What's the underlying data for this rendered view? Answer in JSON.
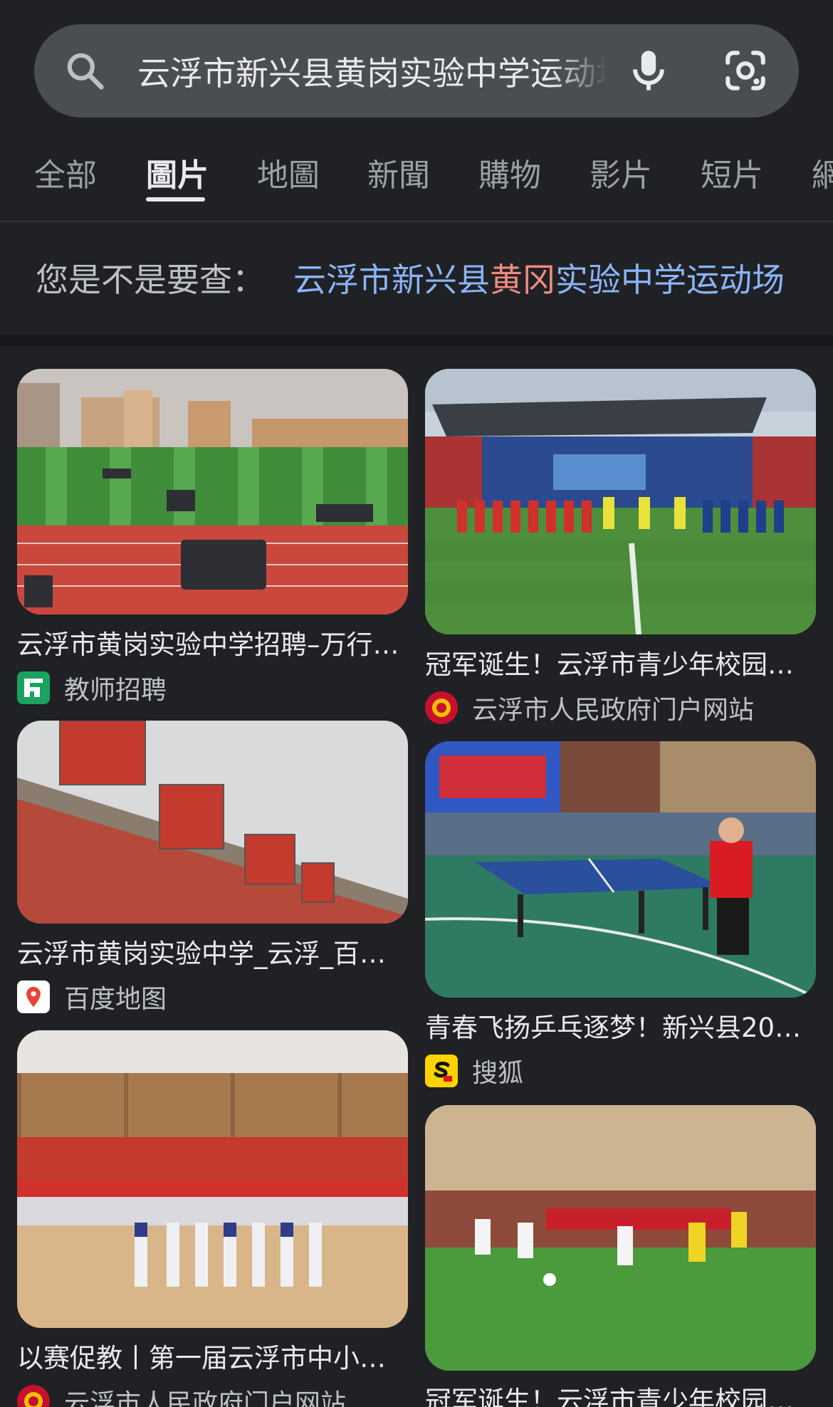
{
  "search": {
    "query": "云浮市新兴县黄岗实验中学运动场",
    "icons": {
      "search": "search-icon",
      "voice": "mic-icon",
      "lens": "google-lens-icon"
    }
  },
  "tabs": [
    {
      "label": "全部",
      "active": false
    },
    {
      "label": "圖片",
      "active": true
    },
    {
      "label": "地圖",
      "active": false
    },
    {
      "label": "新聞",
      "active": false
    },
    {
      "label": "購物",
      "active": false
    },
    {
      "label": "影片",
      "active": false
    },
    {
      "label": "短片",
      "active": false
    },
    {
      "label": "網",
      "active": false
    }
  ],
  "did_you_mean": {
    "label": "您是不是要查：",
    "before": "云浮市新兴县",
    "highlight": "黄冈",
    "after": "实验中学运动场"
  },
  "results": [
    {
      "caption": "云浮市黄岗实验中学招聘–万行…",
      "source": "教师招聘",
      "source_icon": "wanxing-logo-icon",
      "image": "school-sports-field-drill"
    },
    {
      "caption": "冠军诞生！云浮市青少年校园足…",
      "source": "云浮市人民政府门户网站",
      "source_icon": "national-emblem-icon",
      "image": "stadium-football-teams"
    },
    {
      "caption": "云浮市黄岗实验中学_云浮_百…",
      "source": "百度地图",
      "source_icon": "map-pin-icon",
      "image": "school-rooftop-sign"
    },
    {
      "caption": "青春飞扬乒乓逐梦！新兴县202…",
      "source": "搜狐",
      "source_icon": "sohu-logo-icon",
      "image": "table-tennis-match"
    },
    {
      "caption": "以赛促教丨第一届云浮市中小学…",
      "source": "云浮市人民政府门户网站",
      "source_icon": "national-emblem-icon",
      "image": "indoor-gym-students"
    },
    {
      "caption": "冠军诞生！云浮市青少年校园足…",
      "source": "",
      "source_icon": "",
      "image": "football-match-action"
    }
  ],
  "colors": {
    "background": "#202124",
    "search_bg": "#4a4d51",
    "link": "#8ab4f8",
    "highlight": "#f28b82"
  }
}
